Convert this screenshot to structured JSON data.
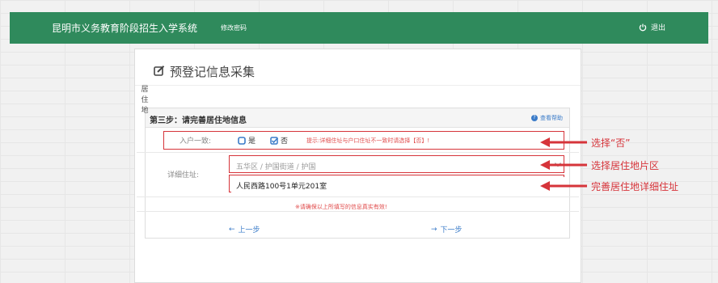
{
  "header": {
    "title": "昆明市义务教育阶段招生入学系统",
    "change_password": "修改密码",
    "logout": "退出"
  },
  "page": {
    "title": "预登记信息采集"
  },
  "step": {
    "title": "第三步：请完善居住地信息",
    "help": "查看帮助",
    "side_label": "居\n住\n地"
  },
  "household": {
    "label": "入户一致:",
    "option_yes": "是",
    "option_no": "否",
    "hint": "提示:详细住址与户口住址不一致时请选择【否】!"
  },
  "address": {
    "label": "详细住址:",
    "region": "五华区 / 护国街道 / 护国",
    "detail": "人民西路100号1单元201室"
  },
  "notice": "※请确保以上所填写的信息真实有效!",
  "nav": {
    "prev": "上一步",
    "next": "下一步"
  },
  "annotations": {
    "a1": "选择“否”",
    "a2": "选择居住地片区",
    "a3": "完善居住地详细住址"
  },
  "colors": {
    "header_bg": "#2f8a5c",
    "annotation_red": "#d6343a",
    "link_blue": "#3a7bc8"
  }
}
